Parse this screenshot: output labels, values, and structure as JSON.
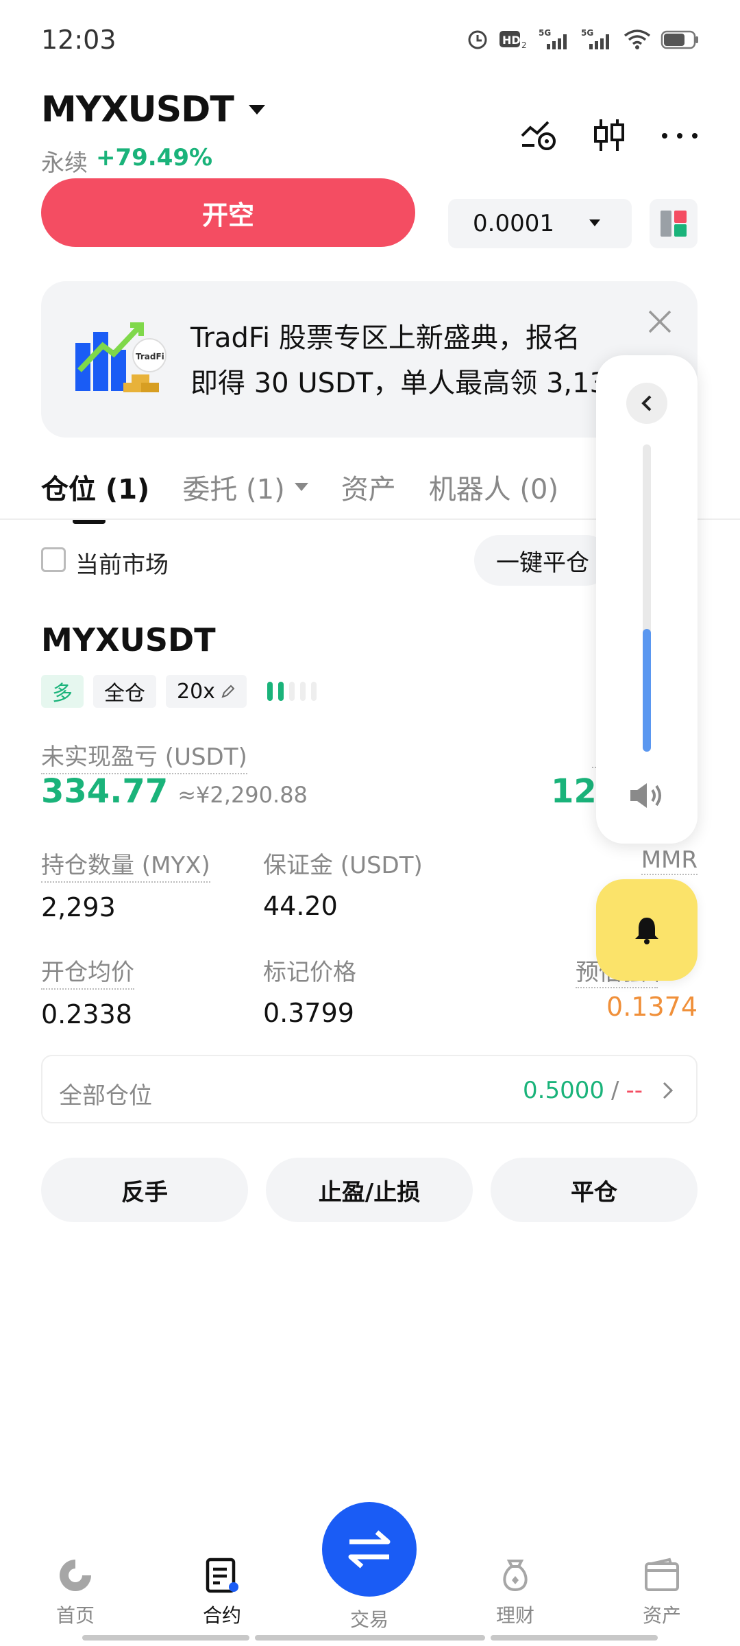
{
  "status_bar": {
    "time": "12:03"
  },
  "header": {
    "pair": "MYXUSDT",
    "contract_type": "永续",
    "change": "+79.49%"
  },
  "actions": {
    "open_short": "开空",
    "precision": "0.0001"
  },
  "banner": {
    "line1": "TradFi 股票专区上新盛典，报名",
    "line2": "即得 30 USDT，单人最高领 3,13",
    "badge_text": "TradFi"
  },
  "tabs": [
    {
      "label": "仓位 (1)"
    },
    {
      "label": "委托 (1)"
    },
    {
      "label": "资产"
    },
    {
      "label": "机器人 (0)"
    }
  ],
  "filter": {
    "current_market_label": "当前市场",
    "close_all_label": "一键平仓"
  },
  "position": {
    "symbol": "MYXUSDT",
    "side": "多",
    "margin_mode": "全仓",
    "leverage": "20x",
    "leverage_level": 0.4,
    "pnl_label": "未实现盈亏 (USDT)",
    "pnl_value": "334.77",
    "pnl_cny": "≈¥2,290.88",
    "roi_value": "123",
    "size_label": "持仓数量 (MYX)",
    "size_value": "2,293",
    "margin_label": "保证金 (USDT)",
    "margin_value": "44.20",
    "mmr_label": "MMR",
    "entry_label": "开仓均价",
    "entry_value": "0.2338",
    "mark_label": "标记价格",
    "mark_value": "0.3799",
    "liq_label": "预估强平价",
    "liq_value": "0.1374"
  },
  "all_positions": {
    "label": "全部仓位",
    "value": "0.5000",
    "separator": "/",
    "tpsl": "--"
  },
  "buttons": {
    "reverse": "反手",
    "tp_sl": "止盈/止损",
    "close": "平仓"
  },
  "volume": {
    "level": 0.4
  },
  "bottom_nav": {
    "home": "首页",
    "contract": "合约",
    "trade": "交易",
    "finance": "理财",
    "assets": "资产"
  },
  "colors": {
    "short": "#f44d62",
    "long": "#1ab37a",
    "accent": "#1a5cf5",
    "warning": "#f0903a"
  }
}
